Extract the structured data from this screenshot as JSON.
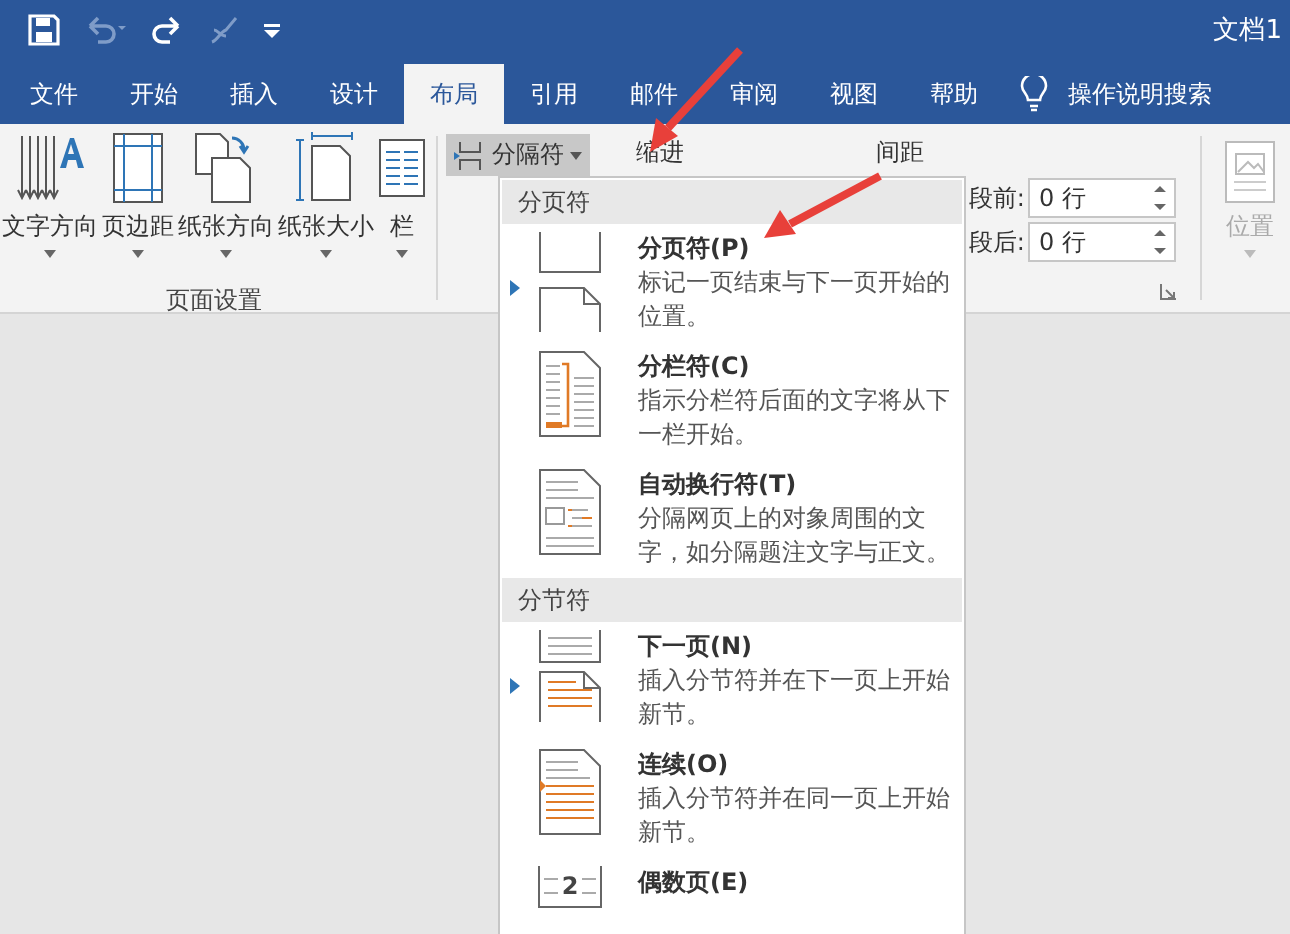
{
  "window": {
    "title": "文档1"
  },
  "tabs": [
    {
      "label": "文件",
      "selected": false
    },
    {
      "label": "开始",
      "selected": false
    },
    {
      "label": "插入",
      "selected": false
    },
    {
      "label": "设计",
      "selected": false
    },
    {
      "label": "布局",
      "selected": true
    },
    {
      "label": "引用",
      "selected": false
    },
    {
      "label": "邮件",
      "selected": false
    },
    {
      "label": "审阅",
      "selected": false
    },
    {
      "label": "视图",
      "selected": false
    },
    {
      "label": "帮助",
      "selected": false
    }
  ],
  "tell_me": {
    "label": "操作说明搜索"
  },
  "page_setup": {
    "buttons": [
      {
        "kind": "text-direction",
        "label": "文字方向"
      },
      {
        "kind": "margins",
        "label": "页边距"
      },
      {
        "kind": "orientation",
        "label": "纸张方向"
      },
      {
        "kind": "size",
        "label": "纸张大小"
      },
      {
        "kind": "columns",
        "label": "栏"
      }
    ],
    "group_label": "页面设置"
  },
  "breaks_button": {
    "label": "分隔符",
    "pressed": true
  },
  "paragraph": {
    "indent_label": "缩进",
    "spacing_label": "间距",
    "fields": [
      {
        "label": "段前:",
        "value": "0 行"
      },
      {
        "label": "段后:",
        "value": "0 行"
      }
    ]
  },
  "arrange": {
    "label": "位置",
    "disabled": true
  },
  "menu": {
    "sections": [
      {
        "heading": "分页符",
        "items": [
          {
            "kind": "page",
            "title": "分页符(P)",
            "description": "标记一页结束与下一页开始的位置。",
            "marker": true
          },
          {
            "kind": "column",
            "title": "分栏符(C)",
            "description": "指示分栏符后面的文字将从下一栏开始。",
            "marker": false
          },
          {
            "kind": "wrap",
            "title": "自动换行符(T)",
            "description": "分隔网页上的对象周围的文字，如分隔题注文字与正文。",
            "marker": false
          }
        ]
      },
      {
        "heading": "分节符",
        "items": [
          {
            "kind": "next",
            "title": "下一页(N)",
            "description": "插入分节符并在下一页上开始新节。",
            "marker": true
          },
          {
            "kind": "continuous",
            "title": "连续(O)",
            "description": "插入分节符并在同一页上开始新节。",
            "marker": false
          },
          {
            "kind": "even",
            "title": "偶数页(E)",
            "icon_text": "2",
            "marker": false
          }
        ]
      }
    ]
  }
}
